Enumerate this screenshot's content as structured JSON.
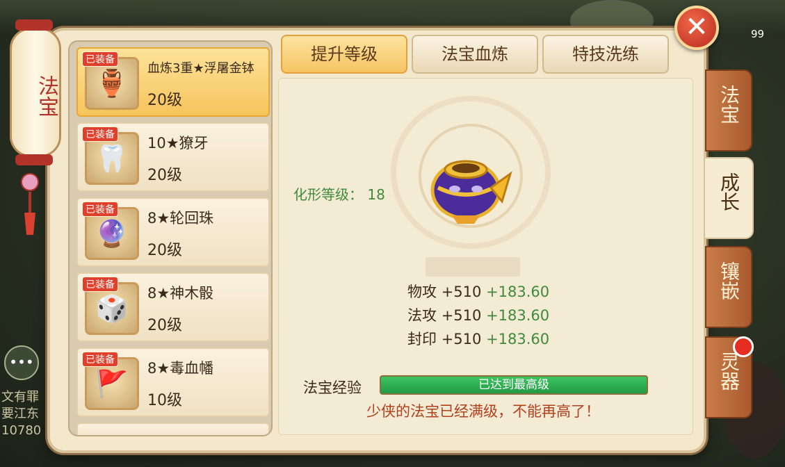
{
  "window": {
    "lantern_title": "法宝",
    "close_label": "✕"
  },
  "tabs": [
    {
      "label": "提升等级",
      "active": true
    },
    {
      "label": "法宝血炼",
      "active": false
    },
    {
      "label": "特技洗练",
      "active": false
    }
  ],
  "side_tabs": [
    {
      "label": "法宝",
      "active": false
    },
    {
      "label": "成长",
      "active": true
    },
    {
      "label": "镶嵌",
      "active": false
    },
    {
      "label": "灵器",
      "active": false,
      "badge": true
    }
  ],
  "treasure_list": [
    {
      "tag": "已装备",
      "name": "血炼3重★浮屠金钵",
      "level": "20级",
      "icon": "golden-bowl-icon",
      "selected": true
    },
    {
      "tag": "已装备",
      "name": "10★獠牙",
      "level": "20级",
      "icon": "fang-icon",
      "selected": false
    },
    {
      "tag": "已装备",
      "name": "8★轮回珠",
      "level": "20级",
      "icon": "orb-icon",
      "selected": false
    },
    {
      "tag": "已装备",
      "name": "8★神木骰",
      "level": "20级",
      "icon": "dice-icon",
      "selected": false
    },
    {
      "tag": "已装备",
      "name": "8★毒血幡",
      "level": "10级",
      "icon": "banner-icon",
      "selected": false
    }
  ],
  "detail": {
    "form_level_label": "化形等级：",
    "form_level_value": "18",
    "stats": [
      {
        "label": "物攻",
        "base": "+510",
        "bonus": "+183.60"
      },
      {
        "label": "法攻",
        "base": "+510",
        "bonus": "+183.60"
      },
      {
        "label": "封印",
        "base": "+510",
        "bonus": "+183.60"
      }
    ],
    "exp_label": "法宝经验",
    "exp_progress": 1.0,
    "exp_bar_text": "已达到最高级",
    "max_message": "少侠的法宝已经满级，不能再高了！"
  },
  "hud": {
    "counter": "99"
  },
  "chat": {
    "lines": [
      "文有罪",
      "要江东",
      "10780"
    ]
  },
  "colors": {
    "selected_item": "#f6c45c",
    "equipped_tag": "#e0402b",
    "bonus_green": "#3f8a3a",
    "exp_bar": "#229a44",
    "close_button": "#b8291c"
  }
}
